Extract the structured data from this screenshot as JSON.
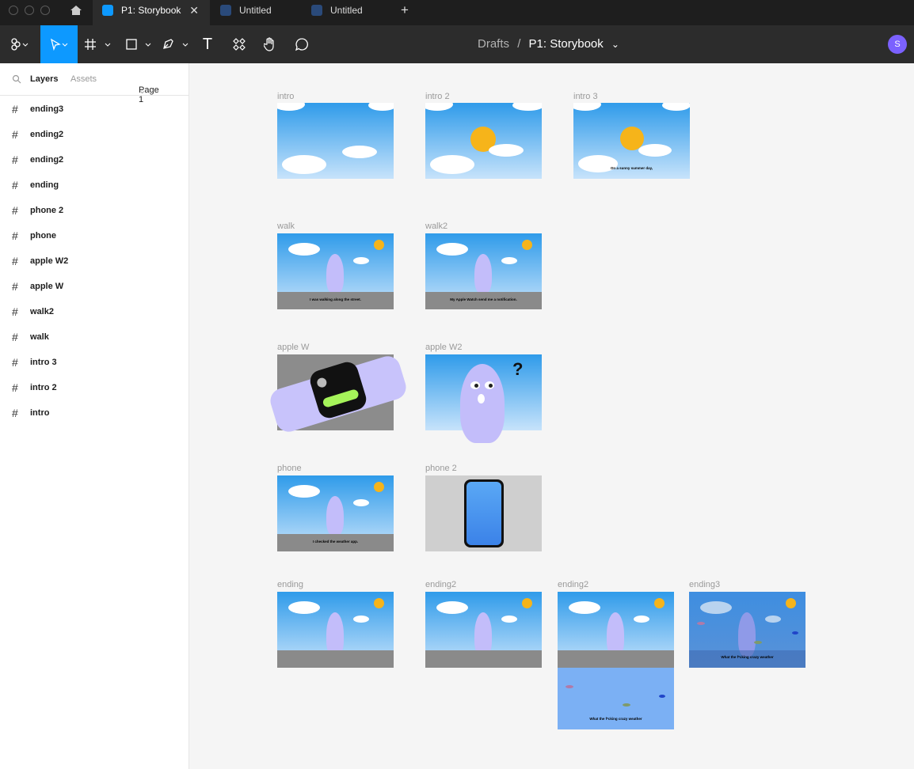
{
  "tabs": [
    {
      "label": "P1: Storybook",
      "close": "✕"
    },
    {
      "label": "Untitled"
    },
    {
      "label": "Untitled"
    }
  ],
  "tab_new": "+",
  "breadcrumb": {
    "root": "Drafts",
    "sep": "/",
    "file": "P1: Storybook",
    "caret": "⌄"
  },
  "user_initial": "S",
  "sidebar": {
    "tab_layers": "Layers",
    "tab_assets": "Assets",
    "page": "Page 1",
    "layers": [
      "ending3",
      "ending2",
      "ending2",
      "ending",
      "phone 2",
      "phone",
      "apple W2",
      "apple W",
      "walk2",
      "walk",
      "intro 3",
      "intro 2",
      "intro"
    ]
  },
  "frames": {
    "intro": "intro",
    "intro2": "intro 2",
    "intro3": "intro 3",
    "walk": "walk",
    "walk2": "walk2",
    "applew": "apple W",
    "applew2": "apple W2",
    "phone": "phone",
    "phone2": "phone 2",
    "ending": "ending",
    "ending2a": "ending2",
    "ending2b": "ending2",
    "ending3": "ending3"
  },
  "captions": {
    "intro3": "On a sunny summer day,",
    "walk": "I was walking along the street.",
    "walk2": "My Apple Watch send me a notification.",
    "phone": "I checked the weather app.",
    "ending2": "What the f*cking crazy weather",
    "ending3": "What the f*cking crazy weather"
  },
  "colors": {
    "accent": "#0d99ff",
    "avatar": "#7b61ff",
    "sun": "#f6b41a",
    "ghost": "#c3bdfa"
  }
}
